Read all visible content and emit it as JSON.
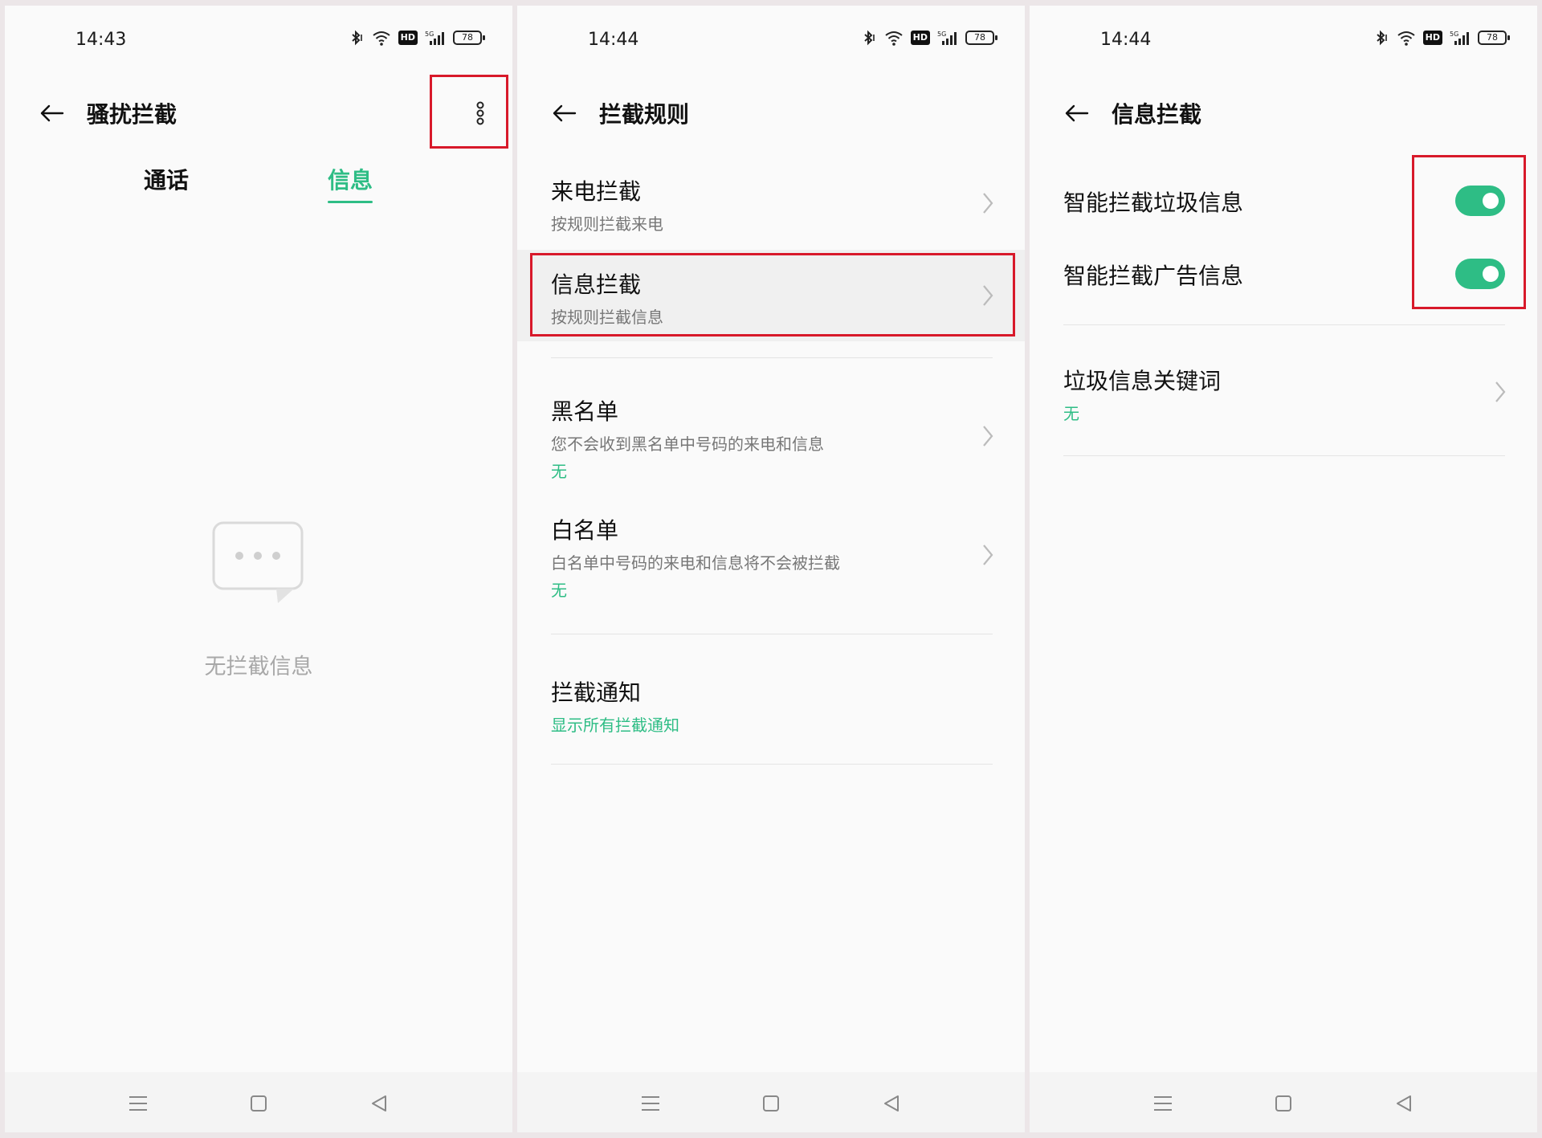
{
  "colors": {
    "accent": "#2ebd85",
    "highlight": "#d8192a"
  },
  "status": {
    "battery": "78",
    "hd": "HD",
    "net": "5G"
  },
  "screen1": {
    "time": "14:43",
    "title": "骚扰拦截",
    "tabs": [
      {
        "label": "通话"
      },
      {
        "label": "信息"
      }
    ],
    "empty_text": "无拦截信息"
  },
  "screen2": {
    "time": "14:44",
    "title": "拦截规则",
    "items": [
      {
        "title": "来电拦截",
        "subtitle": "按规则拦截来电"
      },
      {
        "title": "信息拦截",
        "subtitle": "按规则拦截信息"
      },
      {
        "title": "黑名单",
        "subtitle": "您不会收到黑名单中号码的来电和信息",
        "value": "无"
      },
      {
        "title": "白名单",
        "subtitle": "白名单中号码的来电和信息将不会被拦截",
        "value": "无"
      },
      {
        "title": "拦截通知",
        "value": "显示所有拦截通知"
      }
    ]
  },
  "screen3": {
    "time": "14:44",
    "title": "信息拦截",
    "switches": [
      {
        "label": "智能拦截垃圾信息",
        "on": true
      },
      {
        "label": "智能拦截广告信息",
        "on": true
      }
    ],
    "keywords": {
      "title": "垃圾信息关键词",
      "value": "无"
    }
  }
}
